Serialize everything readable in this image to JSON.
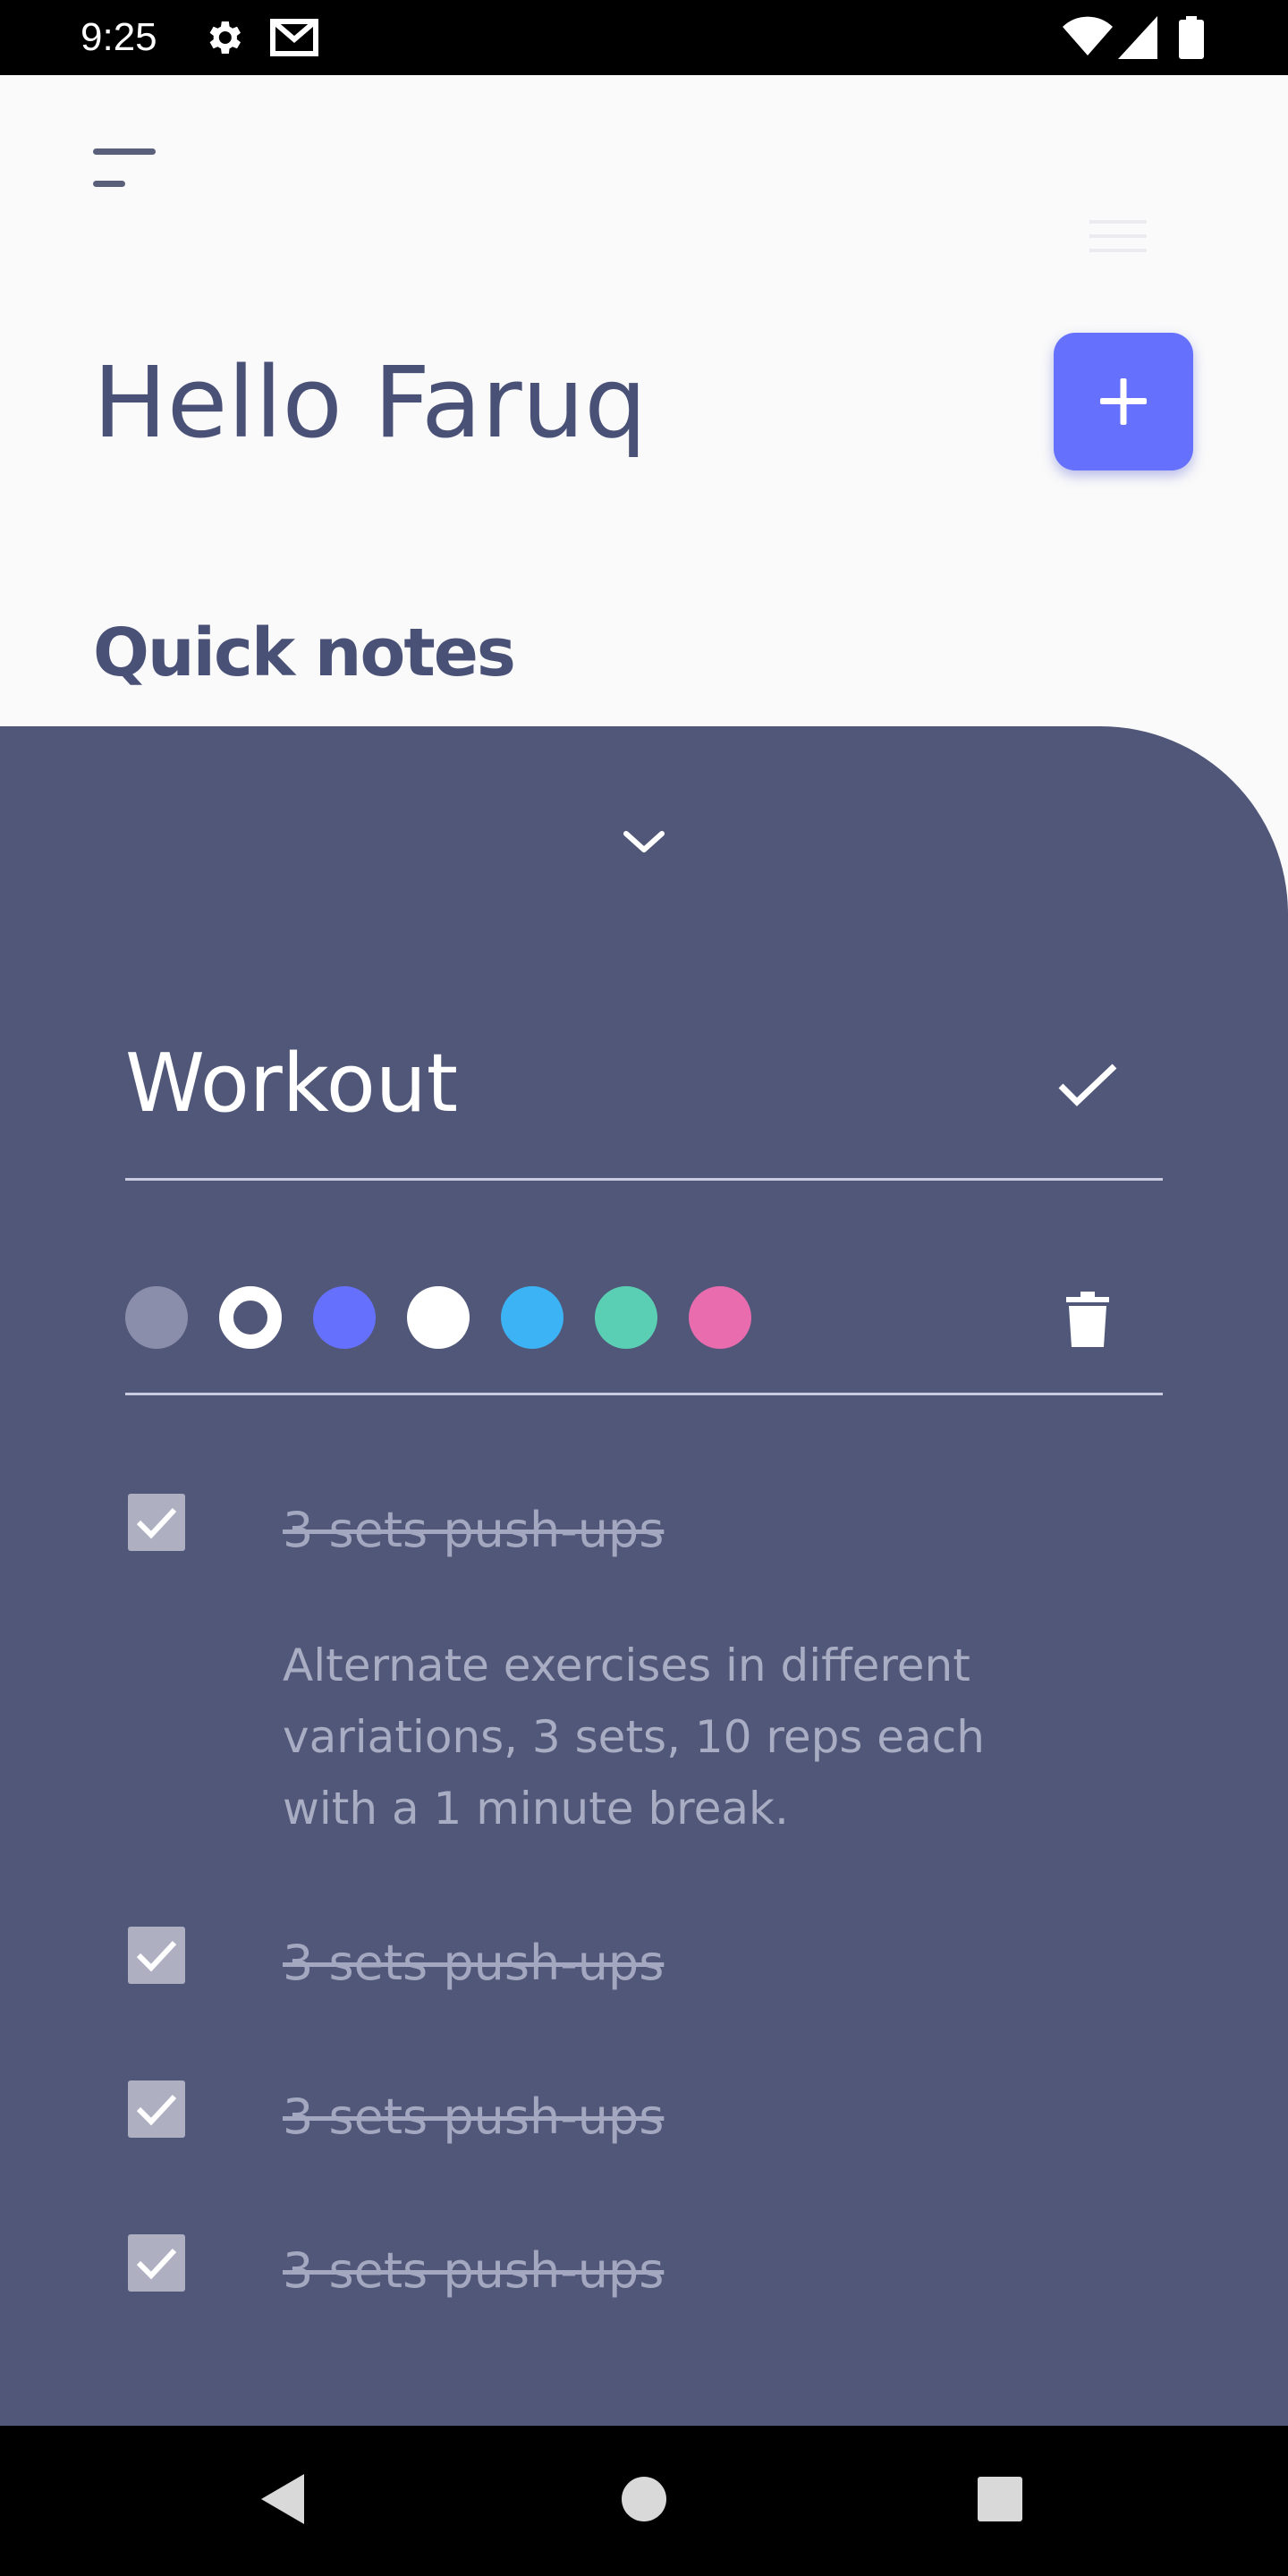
{
  "status_bar": {
    "time": "9:25",
    "icons": [
      "gear-icon",
      "gmail-icon",
      "wifi-icon",
      "signal-icon",
      "battery-icon"
    ]
  },
  "header": {
    "menu_icon": "menu-lines-icon",
    "list_icon": "list-icon",
    "greeting": "Hello Faruq",
    "add_button_icon": "plus-icon"
  },
  "section": {
    "title": "Quick notes"
  },
  "note": {
    "collapse_icon": "chevron-down-icon",
    "title": "Workout",
    "confirm_icon": "check-icon",
    "delete_icon": "trash-icon",
    "colors": [
      {
        "name": "gray",
        "hex": "#8a8eab",
        "selected": false
      },
      {
        "name": "white-ring",
        "hex": "#ffffff",
        "selected": true
      },
      {
        "name": "indigo",
        "hex": "#6571fd",
        "selected": false
      },
      {
        "name": "white",
        "hex": "#ffffff",
        "selected": false
      },
      {
        "name": "sky",
        "hex": "#3cb3f4",
        "selected": false
      },
      {
        "name": "teal",
        "hex": "#5bcfb4",
        "selected": false
      },
      {
        "name": "pink",
        "hex": "#e86cae",
        "selected": false
      }
    ],
    "tasks": [
      {
        "label": "3 sets push-ups",
        "checked": true
      },
      {
        "label": "3 sets push-ups",
        "checked": true
      },
      {
        "label": "3 sets push-ups",
        "checked": true
      },
      {
        "label": "3 sets push-ups",
        "checked": true
      }
    ],
    "description": "Alternate exercises in different variations, 3 sets, 10 reps each with a 1 minute break."
  },
  "nav_bar": {
    "icons": [
      "back-icon",
      "home-icon",
      "recents-icon"
    ]
  },
  "theme": {
    "accent": "#6571fd",
    "sheet_bg": "#515778",
    "text_primary": "#4a5177"
  }
}
